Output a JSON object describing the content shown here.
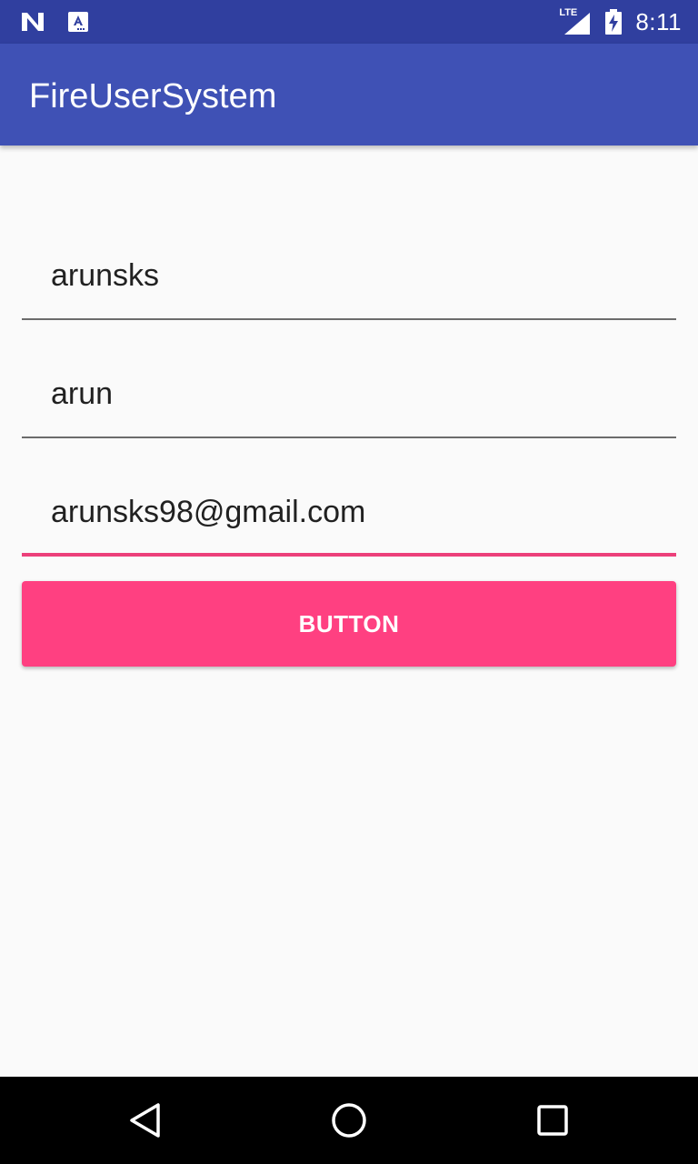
{
  "status_bar": {
    "left_icons": [
      "n-brand-icon",
      "keyboard-a-icon"
    ],
    "network_label": "LTE",
    "time": "8:11"
  },
  "app_bar": {
    "title": "FireUserSystem"
  },
  "form": {
    "fields": [
      {
        "value": "arunsks"
      },
      {
        "value": "arun"
      },
      {
        "value": "arunsks98@gmail.com"
      }
    ],
    "submit_label": "BUTTON"
  },
  "nav_bar": {
    "icons": [
      "back-icon",
      "home-icon",
      "recents-icon"
    ]
  },
  "colors": {
    "status_bar": "#303f9f",
    "app_bar": "#3f51b5",
    "accent": "#ff4081",
    "focused_underline": "#ec407a",
    "background": "#fafafa"
  }
}
